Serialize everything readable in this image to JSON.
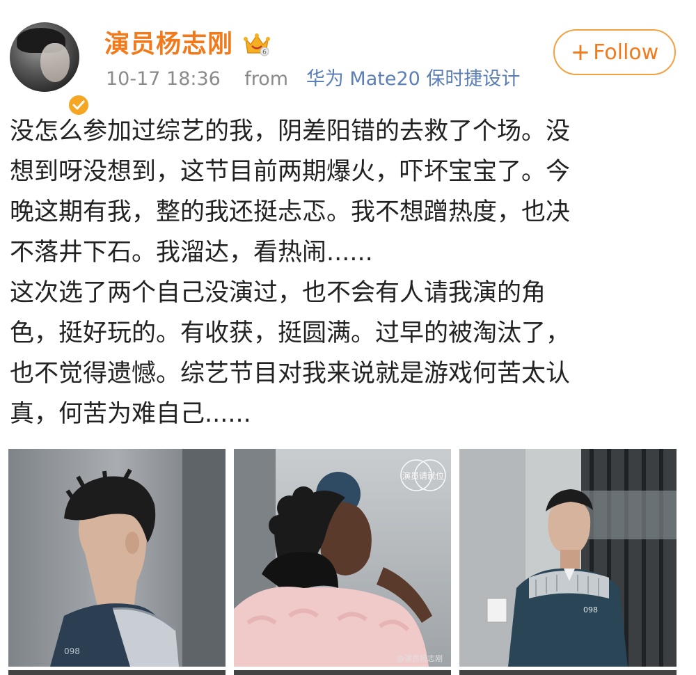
{
  "post": {
    "username": "演员杨志刚",
    "timestamp": "10-17 18:36",
    "from_label": "from",
    "device": "华为 Mate20 保时捷设计",
    "follow_label": "Follow",
    "follow_icon": "plus-icon",
    "crown_badge_level": "6",
    "colors": {
      "username": "#f07a1c",
      "follow_border": "#f5a040",
      "device_link": "#5b7fb6",
      "meta": "#8a8a8a"
    },
    "content_lines": [
      "没怎么参加过综艺的我，阴差阳错的去救了个场。没",
      "想到呀没想到，这节目前两期爆火，吓坏宝宝了。今",
      "晚这期有我，整的我还挺忐忑。我不想蹭热度，也决",
      "不落井下石。我溜达，看热闹......",
      "这次选了两个自己没演过，也不会有人请我演的角",
      "色，挺好玩的。有收获，挺圆满。过早的被淘汰了，",
      "也不觉得遗憾。综艺节目对我来说就是游戏何苦太认",
      "真，何苦为难自己......"
    ],
    "photos": [
      {
        "alt": "profile-side-view"
      },
      {
        "alt": "hug-scene",
        "overlay_logo": "演员请就位"
      },
      {
        "alt": "prisoner-looking-up",
        "uniform_number": "098"
      }
    ],
    "watermark": "@演员杨志刚"
  }
}
